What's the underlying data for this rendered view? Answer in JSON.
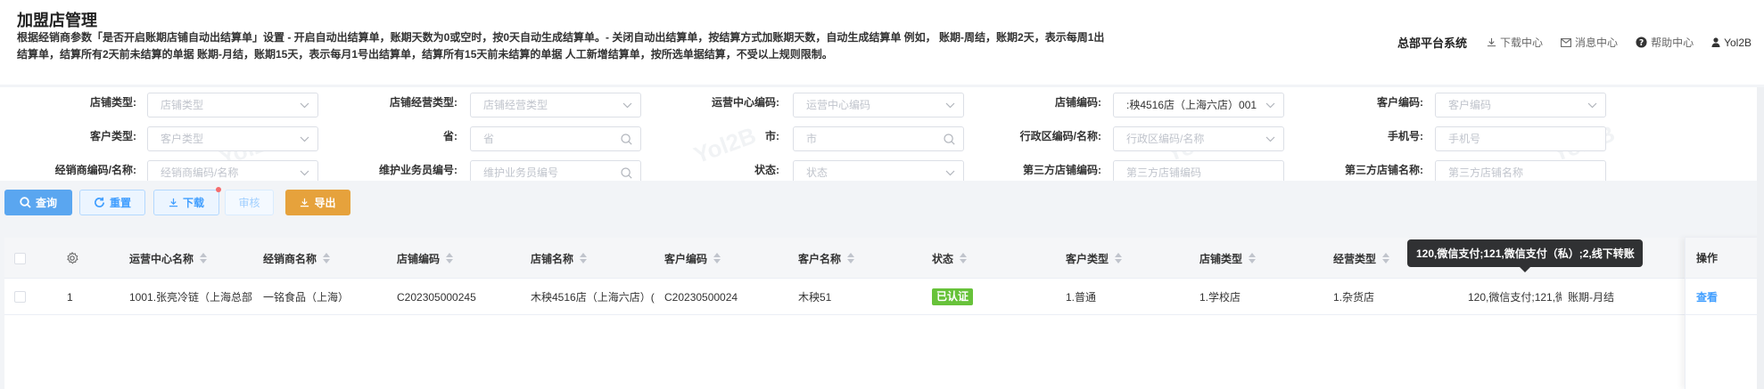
{
  "header": {
    "title": "加盟店管理",
    "description": "根据经销商参数「是否开启账期店铺自动出结算单」设置 - 开启自动出结算单，账期天数为0或空时，按0天自动生成结算单。- 关闭自动出结算单，按结算方式加账期天数，自动生成结算单 例如， 账期-周结，账期2天，表示每周1出结算单，结算所有2天前未结算的单据 账期-月结，账期15天，表示每月1号出结算单，结算所有15天前未结算的单据 人工新增结算单，按所选单据结算，不受以上规则限制。",
    "system_name": "总部平台系统",
    "nav": [
      {
        "label": "下载中心",
        "icon": "download-icon"
      },
      {
        "label": "消息中心",
        "icon": "mail-icon"
      },
      {
        "label": "帮助中心",
        "icon": "help-icon"
      },
      {
        "label": "Yol2B",
        "icon": "user-icon"
      }
    ]
  },
  "filters": {
    "store_type": {
      "label": "店铺类型:",
      "placeholder": "店铺类型"
    },
    "store_business_type": {
      "label": "店铺经营类型:",
      "placeholder": "店铺经营类型"
    },
    "ops_center_code": {
      "label": "运营中心编码:",
      "placeholder": "运营中心编码"
    },
    "store_code": {
      "label": "店铺编码:",
      "value": ":秧4516店（上海六店）001"
    },
    "customer_code": {
      "label": "客户编码:",
      "placeholder": "客户编码"
    },
    "customer_type": {
      "label": "客户类型:",
      "placeholder": "客户类型"
    },
    "province": {
      "label": "省:",
      "placeholder": "省"
    },
    "city": {
      "label": "市:",
      "placeholder": "市"
    },
    "district": {
      "label": "行政区编码/名称:",
      "placeholder": "行政区编码/名称"
    },
    "phone": {
      "label": "手机号:",
      "placeholder": "手机号"
    },
    "dealer": {
      "label": "经销商编码/名称:",
      "placeholder": "经销商编码/名称"
    },
    "maintainer": {
      "label": "维护业务员编号:",
      "placeholder": "维护业务员编号"
    },
    "status": {
      "label": "状态:",
      "placeholder": "状态"
    },
    "third_store_code": {
      "label": "第三方店铺编码:",
      "placeholder": "第三方店铺编码"
    },
    "third_store_name": {
      "label": "第三方店铺名称:",
      "placeholder": "第三方店铺名称"
    }
  },
  "watermark": "Yol2B",
  "buttons": {
    "query": "查询",
    "reset": "重置",
    "download": "下载",
    "audit": "审核",
    "export": "导出"
  },
  "table": {
    "columns": [
      "运营中心名称",
      "经销商名称",
      "店铺编码",
      "店铺名称",
      "客户编码",
      "客户名称",
      "状态",
      "客户类型",
      "店铺类型",
      "经营类型"
    ],
    "action_header": "操作",
    "rows": [
      {
        "index": "1",
        "ops_center": "1001.张亮冷链（上海总部",
        "dealer": "一铭食品（上海）",
        "store_code": "C202305000245",
        "store_name": "木秧4516店（上海六店）(",
        "customer_code": "C20230500024",
        "customer_name": "木秧51",
        "status": "已认证",
        "customer_type": "1.普通",
        "store_type": "1.学校店",
        "business_type": "1.杂货店",
        "payment": "120,微信支付;121,微信支付",
        "period": "账期-月结",
        "action": "查看"
      }
    ]
  },
  "tooltip": "120,微信支付;121,微信支付（私）;2,线下转账",
  "colors": {
    "primary": "#409eff",
    "warning": "#e6a23c",
    "success": "#67c23a"
  }
}
